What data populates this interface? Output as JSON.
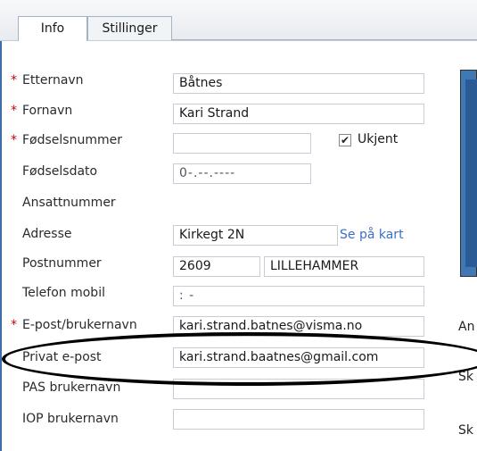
{
  "tabs": [
    {
      "label": "Info"
    },
    {
      "label": "Stillinger"
    }
  ],
  "required_marker": "*",
  "form": {
    "etternavn": {
      "label": "Etternavn",
      "value": "Båtnes"
    },
    "fornavn": {
      "label": "Fornavn",
      "value": "Kari Strand"
    },
    "fodselsnummer": {
      "label": "Fødselsnummer",
      "value": ""
    },
    "ukjent": {
      "label": "Ukjent",
      "checked": true,
      "mark": "✔"
    },
    "fodselsdato": {
      "label": "Fødselsdato",
      "value": "0-.--.----"
    },
    "ansattnummer": {
      "label": "Ansattnummer"
    },
    "adresse": {
      "label": "Adresse",
      "value": "Kirkegt 2N"
    },
    "se_pa_kart": "Se på kart",
    "postnummer": {
      "label": "Postnummer",
      "value": "2609",
      "city": "LILLEHAMMER"
    },
    "telefon_mobil": {
      "label": "Telefon mobil",
      "value": ":          -"
    },
    "epost_brukernavn": {
      "label": "E-post/brukernavn",
      "value": "kari.strand.batnes@visma.no"
    },
    "privat_epost": {
      "label": "Privat e-post",
      "value": "kari.strand.baatnes@gmail.com"
    },
    "pas_brukernavn": {
      "label": "PAS brukernavn",
      "value": ""
    },
    "iop_brukernavn": {
      "label": "IOP brukernavn",
      "value": ""
    }
  },
  "side_text": {
    "an": "An",
    "sk1": "Sk",
    "sk2": "Sk"
  }
}
